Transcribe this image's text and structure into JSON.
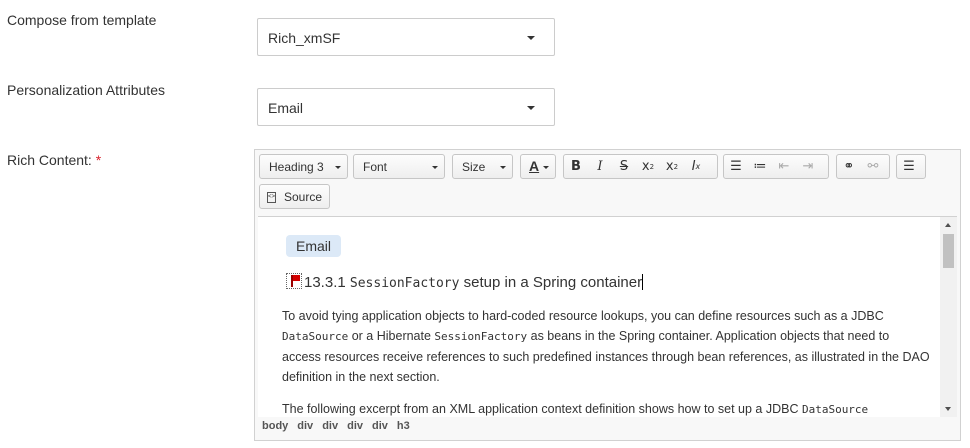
{
  "template": {
    "label": "Compose from template",
    "value": "Rich_xmSF"
  },
  "personalization": {
    "label": "Personalization Attributes",
    "value": "Email"
  },
  "rich": {
    "label": "Rich Content:",
    "required_mark": "*"
  },
  "toolbar": {
    "format": "Heading 3",
    "font": "Font",
    "size": "Size",
    "text_color": "A",
    "source": "Source"
  },
  "content": {
    "pill": "Email",
    "heading": {
      "prefix": "13.3.1",
      "code": "SessionFactory",
      "suffix": "setup in a Spring container"
    },
    "para1": {
      "t1": "To avoid tying application objects to hard-coded resource lookups, you can define resources such as a JDBC",
      "c1": "DataSource",
      "t2": "or a Hibernate",
      "c2": "SessionFactory",
      "t3": "as beans in the Spring container. Application objects that need to access resources receive references to such predefined instances through bean references, as illustrated in the DAO definition in the next section."
    },
    "para2": {
      "t1": "The following excerpt from an XML application context definition shows how to set up a JDBC",
      "c1": "DataSource"
    }
  },
  "elements_path": [
    "body",
    "div",
    "div",
    "div",
    "div",
    "h3"
  ],
  "colors": {
    "required": "#d9232d",
    "pill_bg": "#dce9f7",
    "flag": "#d40000"
  }
}
